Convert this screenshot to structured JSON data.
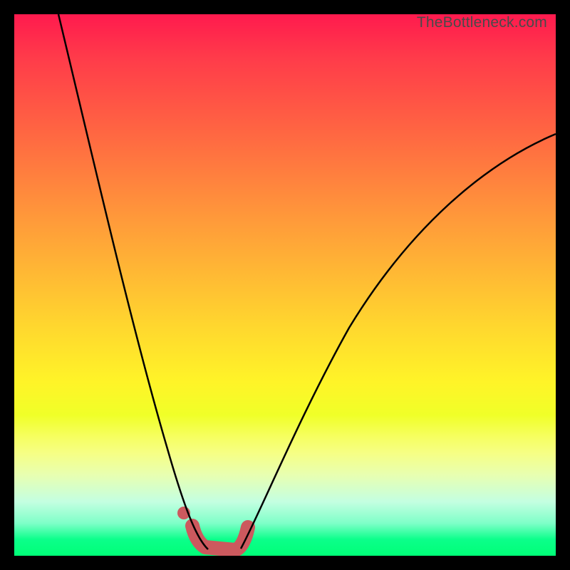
{
  "watermark": "TheBottleneck.com",
  "chart_data": {
    "type": "line",
    "title": "",
    "xlabel": "",
    "ylabel": "",
    "xlim": [
      0,
      100
    ],
    "ylim": [
      0,
      100
    ],
    "series": [
      {
        "name": "left-curve",
        "x": [
          8,
          12,
          16,
          20,
          24,
          28,
          30,
          32,
          33.5,
          35
        ],
        "y": [
          100,
          82,
          64,
          48,
          33,
          20,
          13,
          8,
          4,
          1
        ]
      },
      {
        "name": "right-curve",
        "x": [
          42,
          45,
          50,
          56,
          63,
          72,
          82,
          92,
          100
        ],
        "y": [
          2,
          8,
          18,
          30,
          42,
          54,
          64,
          72,
          78
        ]
      },
      {
        "name": "highlighted-minimum",
        "x": [
          33,
          35,
          38,
          41,
          43
        ],
        "y": [
          3,
          1,
          0.5,
          1,
          3
        ]
      }
    ],
    "annotations": [
      {
        "type": "point",
        "x": 31,
        "y": 6,
        "label": "marker-dot"
      }
    ],
    "gradient_bands": [
      "#ff1a4e",
      "#ff7a3f",
      "#ffd82e",
      "#f6ff60",
      "#c4ffe1",
      "#00ff77"
    ]
  }
}
